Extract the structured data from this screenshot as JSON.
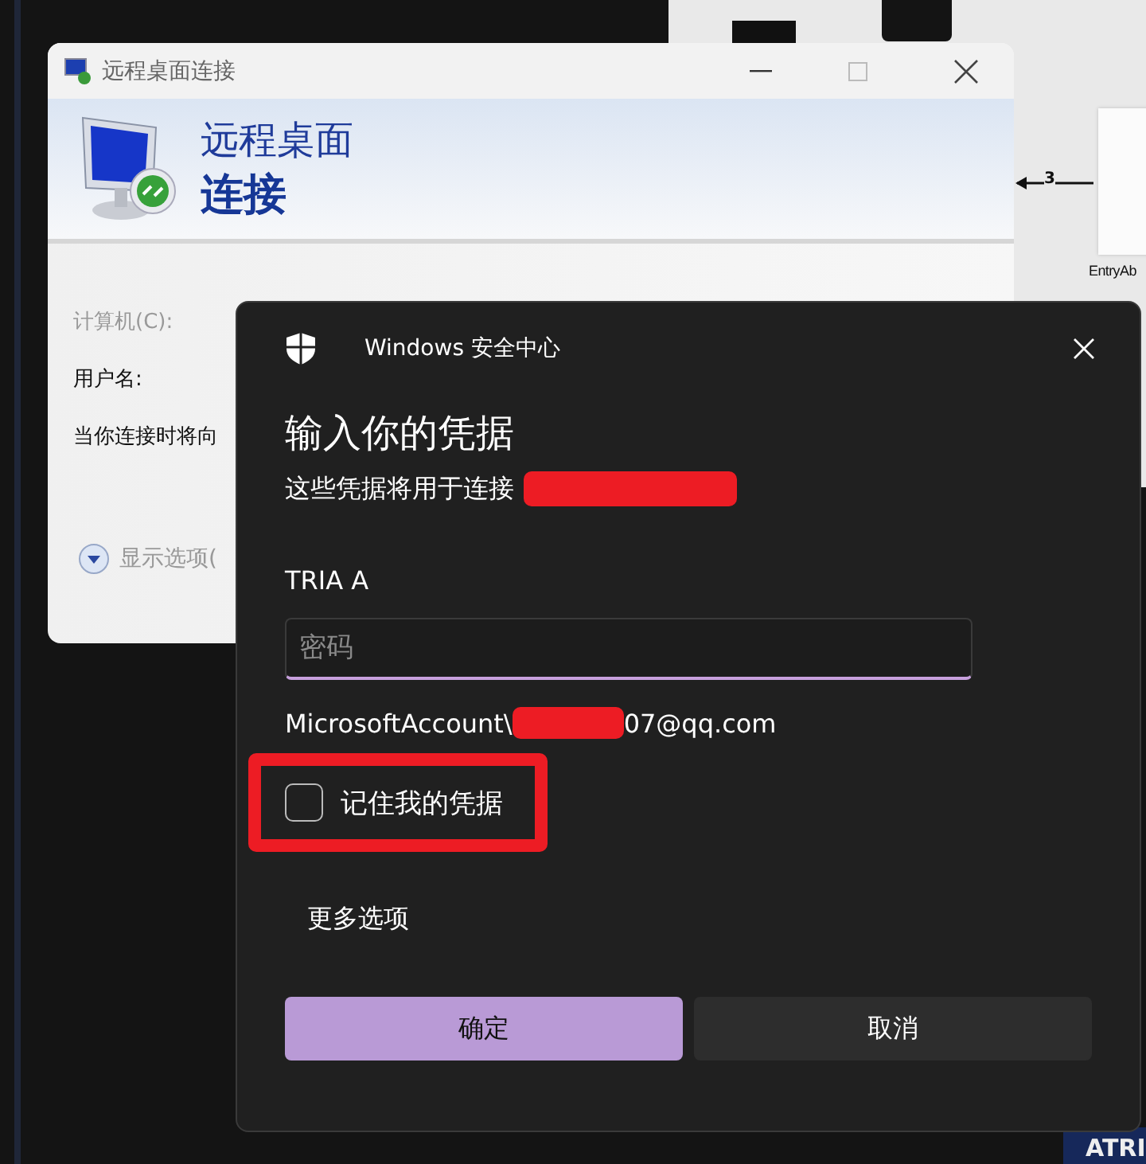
{
  "background": {
    "canvas_label": "EntryAb",
    "arrow_label": "3",
    "corner_label": "ATRI"
  },
  "rdp_window": {
    "title": "远程桌面连接",
    "banner_line1": "远程桌面",
    "banner_line2": "连接",
    "fields": [
      {
        "label": "计算机(C):",
        "disabled": true
      },
      {
        "label": "用户名:",
        "disabled": false
      }
    ],
    "note": "当你连接时将向",
    "options_toggle": "显示选项("
  },
  "security_dialog": {
    "app_name": "Windows 安全中心",
    "heading": "输入你的凭据",
    "subtitle": "这些凭据将用于连接",
    "user_name": "TRIA A",
    "password": {
      "placeholder": "密码"
    },
    "account_prefix": "MicrosoftAccount\\",
    "account_suffix": "07@qq.com",
    "remember": {
      "label": "记住我的凭据",
      "checked": false
    },
    "more_options": "更多选项",
    "buttons": [
      {
        "label": "确定",
        "kind": "primary"
      },
      {
        "label": "取消",
        "kind": "secondary"
      }
    ]
  }
}
